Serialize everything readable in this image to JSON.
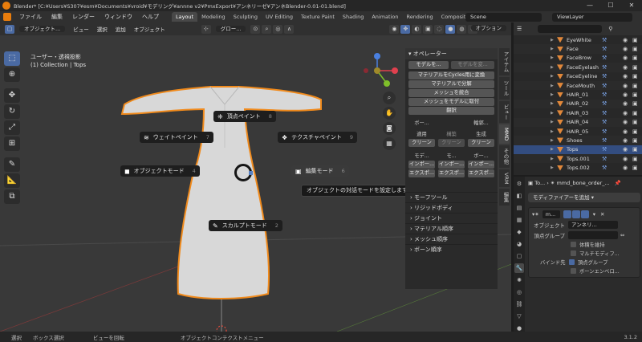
{
  "title_bar": {
    "title": "Blender* [C:¥Users¥S307¥esm¥Documents¥vroid¥モデリング¥annne v2¥PmxExport¥アンネリーゼ¥アンネBlender-0.01-01.blend]",
    "minimize": "—",
    "maximize": "☐",
    "close": "✕"
  },
  "menu": {
    "items": [
      "ファイル",
      "編集",
      "レンダー",
      "ウィンドウ",
      "ヘルプ"
    ],
    "workspaces": [
      "Layout",
      "Modeling",
      "Sculpting",
      "UV Editing",
      "Texture Paint",
      "Shading",
      "Animation",
      "Rendering",
      "Compositing",
      "G"
    ],
    "active_workspace": "Layout",
    "scene": "Scene",
    "view_layer": "ViewLayer"
  },
  "viewport_header": {
    "mode": "オブジェクト...",
    "view": "ビュー",
    "select": "選択",
    "add": "追加",
    "object": "オブジェクト",
    "transform": "グロー...",
    "options": "オプション"
  },
  "viewport": {
    "view_name": "ユーザー・透視投影",
    "collection_line": "(1) Collection | Tops"
  },
  "pie_menu": {
    "items": [
      {
        "label": "頂点ペイント",
        "num": "8",
        "icon": "vertex-paint-icon",
        "glyph": "❈"
      },
      {
        "label": "ウェイトペイント",
        "num": "7",
        "icon": "weight-paint-icon",
        "glyph": "≋"
      },
      {
        "label": "テクスチャペイント",
        "num": "9",
        "icon": "texture-paint-icon",
        "glyph": "❖"
      },
      {
        "label": "オブジェクトモード",
        "num": "4",
        "icon": "object-mode-icon",
        "glyph": "◼"
      },
      {
        "label": "編集モード",
        "num": "6",
        "icon": "edit-mode-icon",
        "glyph": "▣"
      },
      {
        "label": "スカルプトモード",
        "num": "2",
        "icon": "sculpt-mode-icon",
        "glyph": "✎"
      }
    ],
    "tooltip": "オブジェクトの対話モードを設定します: 編集モード"
  },
  "npanel": {
    "operator_header": "オペレーター",
    "to_model": "モデルを...",
    "to_model_dim": "モデルを変...",
    "buttons": [
      "マテリアルをCycles用に変換",
      "マテリアルで分解",
      "メッシュを統合",
      "メッシュをモデルに取付",
      "翻訳"
    ],
    "col_headers": [
      "ボー...",
      "",
      "輪郭..."
    ],
    "apply": "適用",
    "build": "構築",
    "generate": "生成",
    "clean": "クリーン",
    "io_headers": [
      "モデ...",
      "モ...",
      "ボー..."
    ],
    "import": "インポー...",
    "export": "エクスポ...",
    "sections": [
      "モーフツール",
      "リジッドボディ",
      "ジョイント",
      "マテリアル順序",
      "メッシュ順序",
      "ボーン順序"
    ]
  },
  "vertical_tabs": [
    "アイテム",
    "ツール",
    "ビュー",
    "MMD",
    "その他",
    "VRM",
    "編集"
  ],
  "outliner": {
    "rows": [
      {
        "name": "EyeWhite",
        "selected": false
      },
      {
        "name": "Face",
        "selected": false
      },
      {
        "name": "FaceBrow",
        "selected": false
      },
      {
        "name": "FaceEyelash",
        "selected": false
      },
      {
        "name": "FaceEyeline",
        "selected": false
      },
      {
        "name": "FaceMouth",
        "selected": false
      },
      {
        "name": "HAIR_01",
        "selected": false
      },
      {
        "name": "HAIR_02",
        "selected": false
      },
      {
        "name": "HAIR_03",
        "selected": false
      },
      {
        "name": "HAIR_04",
        "selected": false
      },
      {
        "name": "HAIR_05",
        "selected": false
      },
      {
        "name": "Shoes",
        "selected": false
      },
      {
        "name": "Tops",
        "selected": true
      },
      {
        "name": "Tops.001",
        "selected": false
      },
      {
        "name": "Tops.002",
        "selected": false
      }
    ]
  },
  "properties": {
    "object_name": "To...",
    "armature": "mmd_bone_order_...",
    "add_modifier": "モディファイアーを追加",
    "modifier_name": "m...",
    "object_label": "オブジェクト",
    "object_value": "アンネリ...",
    "vertex_group_label": "頂点グループ",
    "preserve_volume": "体積を維持",
    "multi_modifier": "マルチモディフ...",
    "bind_to": "バインド先",
    "bind_vertex_group": "頂点グループ",
    "bone_envelope": "ボーンエンベロ..."
  },
  "status": {
    "select": "選択",
    "box_select": "ボックス選択",
    "rotate_view": "ビューを回転",
    "context_menu": "オブジェクトコンテクストメニュー",
    "version": "3.1.2"
  }
}
